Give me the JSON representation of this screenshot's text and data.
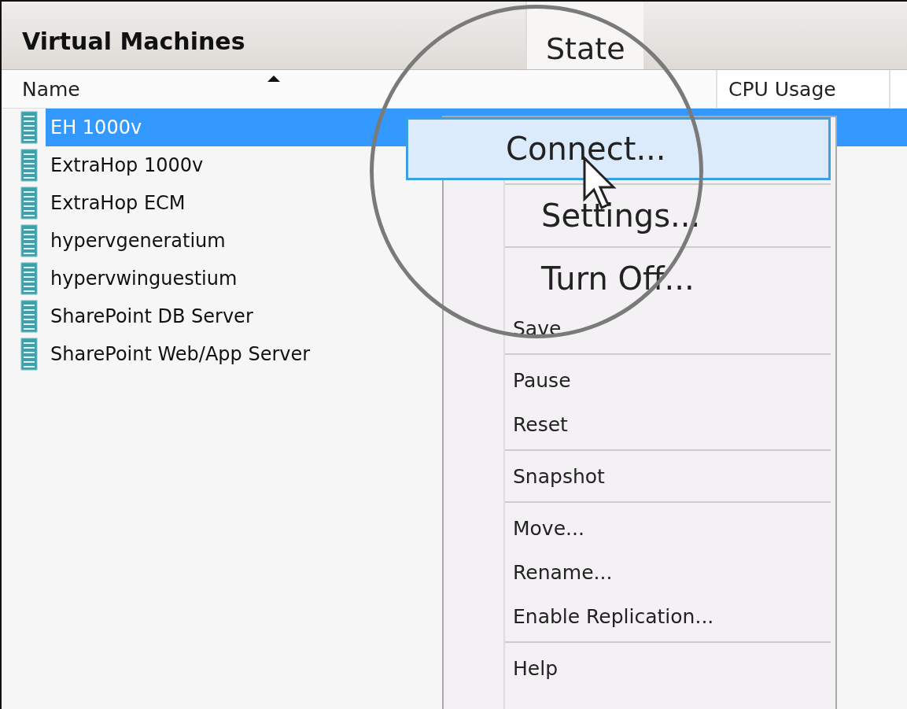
{
  "panel": {
    "title": "Virtual Machines"
  },
  "magnified_header": "State",
  "columns": [
    {
      "label": "Name",
      "sorted": true
    },
    {
      "label": "CPU Usage",
      "sorted": false
    }
  ],
  "rows": [
    {
      "name": "EH 1000v",
      "selected": true
    },
    {
      "name": "ExtraHop 1000v",
      "selected": false
    },
    {
      "name": "ExtraHop ECM",
      "selected": false
    },
    {
      "name": "hypervgeneratium",
      "selected": false
    },
    {
      "name": "hypervwinguestium",
      "selected": false
    },
    {
      "name": "SharePoint DB Server",
      "selected": false
    },
    {
      "name": "SharePoint Web/App Server",
      "selected": false
    }
  ],
  "context_menu": {
    "items": [
      {
        "kind": "item",
        "label": "Connect...",
        "magnified": true,
        "selected": true
      },
      {
        "kind": "separator"
      },
      {
        "kind": "item",
        "label": "Settings...",
        "magnified": true,
        "selected": false
      },
      {
        "kind": "separator"
      },
      {
        "kind": "item",
        "label": "Turn Off...",
        "magnified": true,
        "selected": false
      },
      {
        "kind": "item",
        "label": "Save",
        "magnified": false,
        "selected": false
      },
      {
        "kind": "separator"
      },
      {
        "kind": "item",
        "label": "Pause",
        "magnified": false,
        "selected": false
      },
      {
        "kind": "item",
        "label": "Reset",
        "magnified": false,
        "selected": false
      },
      {
        "kind": "separator"
      },
      {
        "kind": "item",
        "label": "Snapshot",
        "magnified": false,
        "selected": false
      },
      {
        "kind": "separator"
      },
      {
        "kind": "item",
        "label": "Move...",
        "magnified": false,
        "selected": false
      },
      {
        "kind": "item",
        "label": "Rename...",
        "magnified": false,
        "selected": false
      },
      {
        "kind": "item",
        "label": "Enable Replication...",
        "magnified": false,
        "selected": false
      },
      {
        "kind": "separator"
      },
      {
        "kind": "item",
        "label": "Help",
        "magnified": false,
        "selected": false
      }
    ]
  }
}
